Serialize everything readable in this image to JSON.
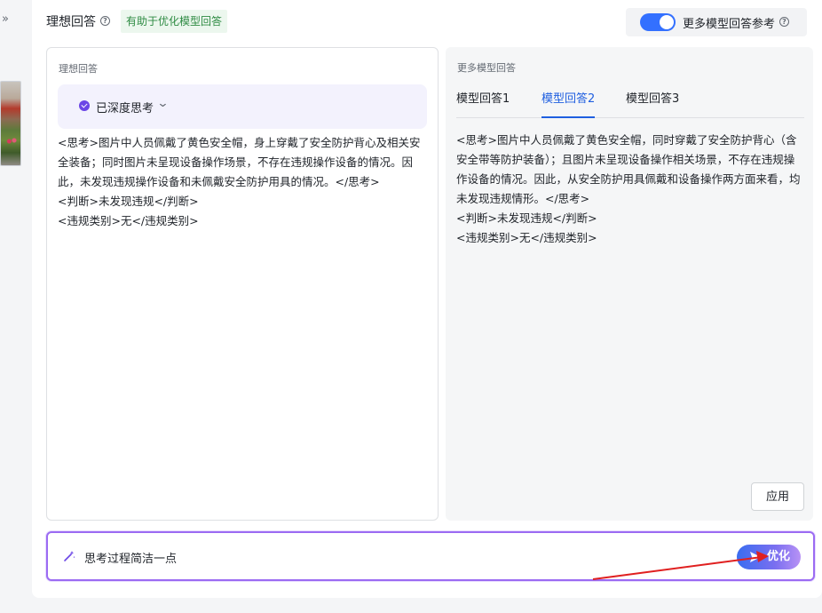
{
  "sidebar": {
    "expand_glyph": "»"
  },
  "header": {
    "title": "理想回答",
    "hint_badge": "有助于优化模型回答",
    "toggle_label": "更多模型回答参考",
    "toggle_on": true
  },
  "ideal": {
    "label": "理想回答",
    "think_status": "已深度思考",
    "answer": "<思考>图片中人员佩戴了黄色安全帽，身上穿戴了安全防护背心及相关安全装备；同时图片未呈现设备操作场景，不存在违规操作设备的情况。因此，未发现违规操作设备和未佩戴安全防护用具的情况。</思考>\n<判断>未发现违规</判断>\n<违规类别>无</违规类别>"
  },
  "more": {
    "label": "更多模型回答",
    "tabs": [
      {
        "label": "模型回答1",
        "active": false
      },
      {
        "label": "模型回答2",
        "active": true
      },
      {
        "label": "模型回答3",
        "active": false
      }
    ],
    "answer": "<思考>图片中人员佩戴了黄色安全帽，同时穿戴了安全防护背心（含安全带等防护装备）；且图片未呈现设备操作相关场景，不存在违规操作设备的情况。因此，从安全防护用具佩戴和设备操作两方面来看，均未发现违规情形。</思考>\n<判断>未发现违规</判断>\n<违规类别>无</违规类别>",
    "apply_label": "应用"
  },
  "prompt": {
    "text": "思考过程简洁一点",
    "optimize_label": "优化"
  },
  "colors": {
    "accent": "#3370ff",
    "purple": "#6b45e6",
    "annotation_arrow": "#e02020"
  }
}
